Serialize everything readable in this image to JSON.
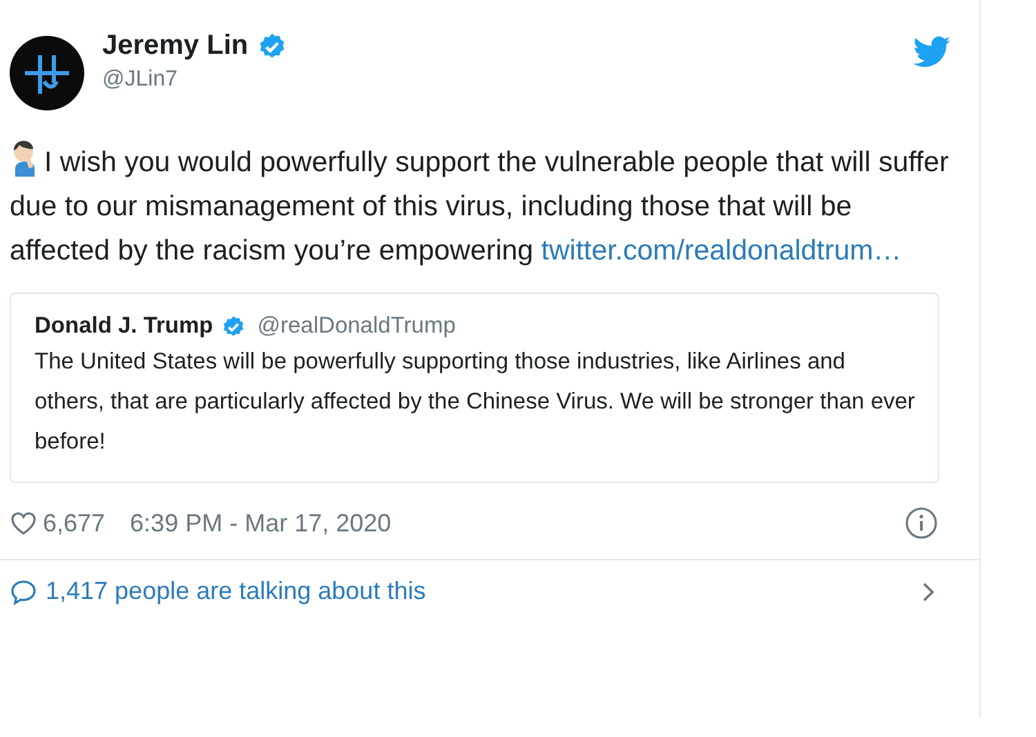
{
  "author": {
    "name": "Jeremy Lin",
    "handle": "@JLin7",
    "verified": true
  },
  "body": {
    "text": "I wish you would powerfully support the vulnerable people that will suffer due to our mismanagement of this virus, including those that will be affected by the racism you’re empowering",
    "link": "twitter.com/realdonaldtrum…"
  },
  "quoted_tweet": {
    "name": "Donald J. Trump",
    "handle": "@realDonaldTrump",
    "verified": true,
    "text": "The United States will be powerfully supporting those industries, like Airlines and others, that are particularly affected by the Chinese Virus. We will be stronger than ever before!"
  },
  "footer": {
    "likes": "6,677",
    "timestamp": "6:39 PM - Mar 17, 2020"
  },
  "conversation": {
    "label": "1,417 people are talking about this"
  }
}
